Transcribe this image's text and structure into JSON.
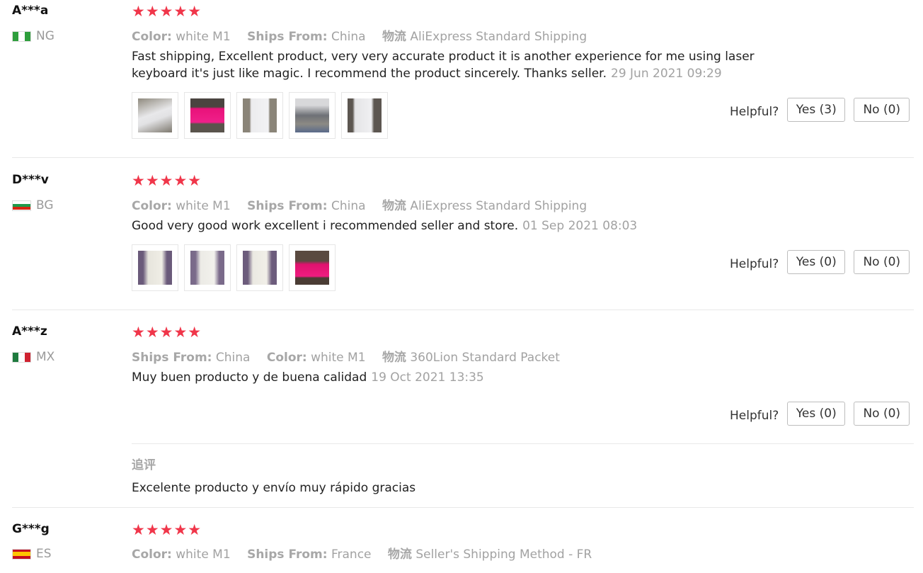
{
  "labels": {
    "color": "Color:",
    "ships_from": "Ships From:",
    "logistics": "物流",
    "helpful": "Helpful?",
    "follow_up": "追评"
  },
  "reviews": [
    {
      "user": "A***a",
      "country": "NG",
      "stars": "★★★★★",
      "color": "white M1",
      "ships_from": "China",
      "logistics": "AliExpress Standard Shipping",
      "text": "Fast shipping, Excellent product, very very accurate product it is another experience for me using laser keyboard it's just like magic. I recommend the product sincerely. Thanks seller.",
      "date": "29 Jun 2021 09:29",
      "yes": "Yes (3)",
      "no": "No (0)"
    },
    {
      "user": "D***v",
      "country": "BG",
      "stars": "★★★★★",
      "color": "white M1",
      "ships_from": "China",
      "logistics": "AliExpress Standard Shipping",
      "text": "Good very good work excellent i recommended seller and store.",
      "date": "01 Sep 2021 08:03",
      "yes": "Yes (0)",
      "no": "No (0)"
    },
    {
      "user": "A***z",
      "country": "MX",
      "stars": "★★★★★",
      "ships_from": "China",
      "color": "white M1",
      "logistics": "360Lion Standard Packet",
      "text": "Muy buen producto y de buena calidad",
      "date": "19 Oct 2021 13:35",
      "yes": "Yes (0)",
      "no": "No (0)",
      "follow_up_text": "Excelente producto y envío muy rápido gracias"
    },
    {
      "user": "G***g",
      "country": "ES",
      "stars": "★★★★★",
      "color": "white M1",
      "ships_from": "France",
      "logistics": "Seller's Shipping Method - FR"
    }
  ],
  "colors": {
    "star": "#f0364a",
    "meta_gray": "#a2a2a2",
    "divider": "#e8e8e8"
  }
}
